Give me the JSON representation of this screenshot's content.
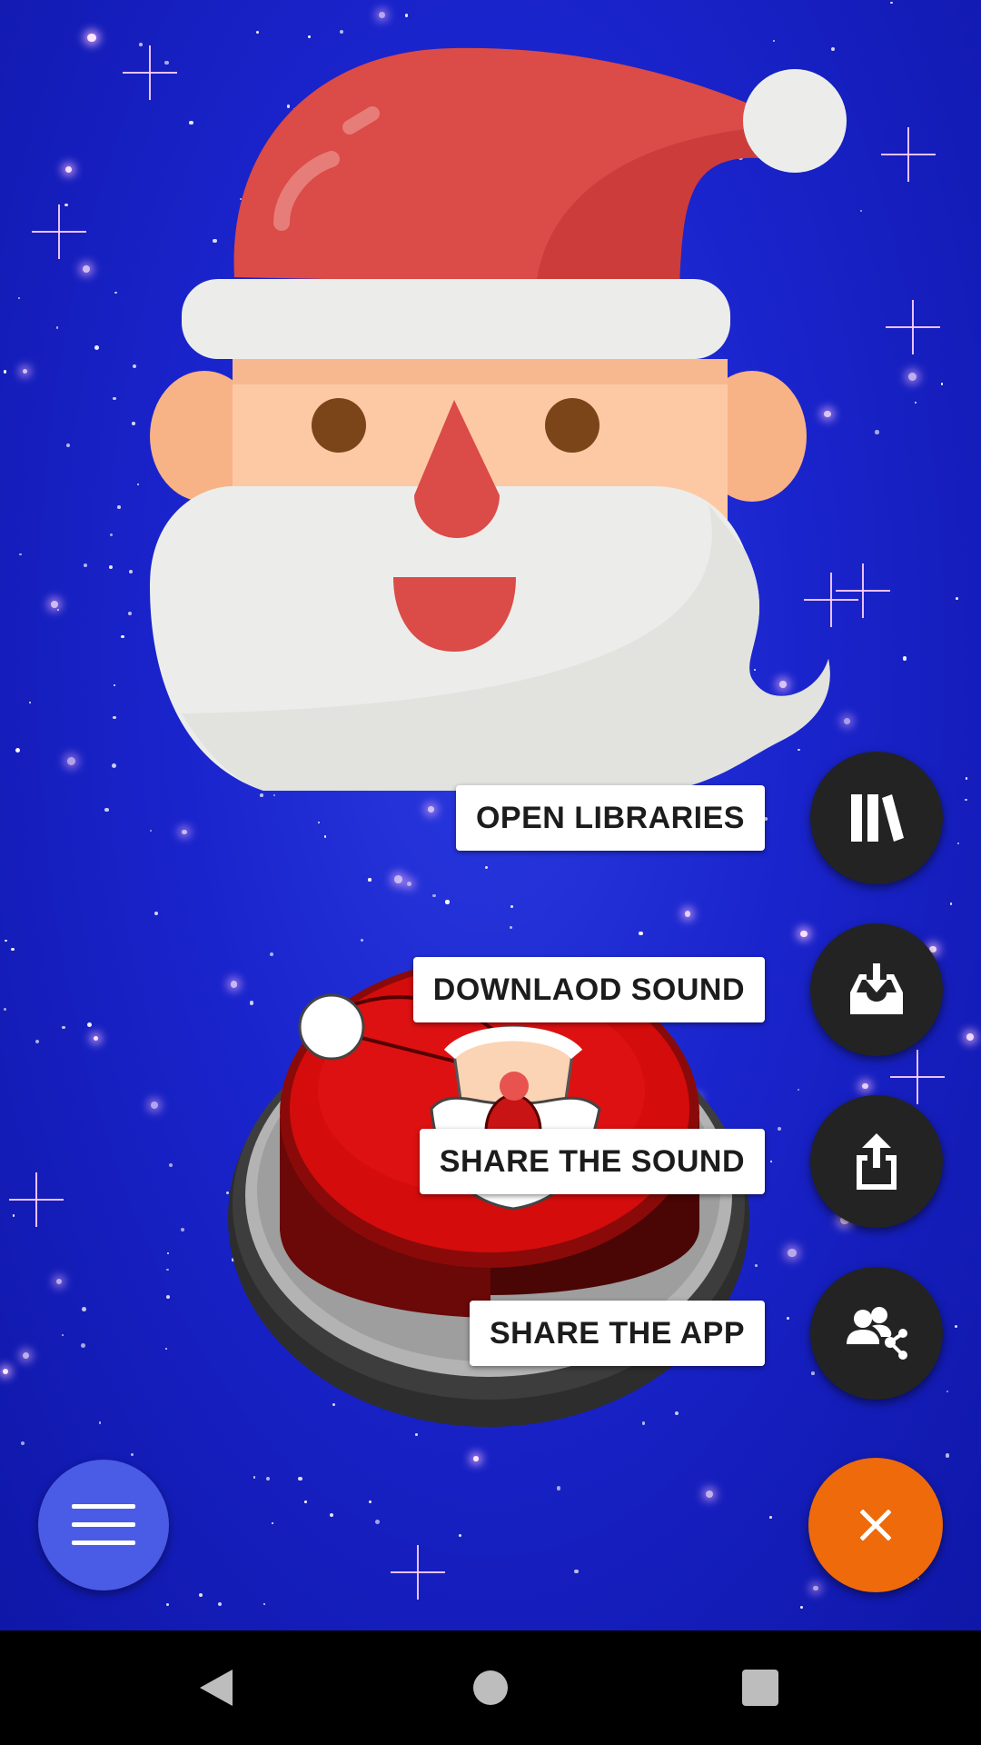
{
  "fab_menu": {
    "items": [
      {
        "label": "OPEN LIBRARIES",
        "icon": "library-icon"
      },
      {
        "label": "DOWNLAOD SOUND",
        "icon": "download-icon"
      },
      {
        "label": "SHARE THE SOUND",
        "icon": "share-icon"
      },
      {
        "label": "SHARE THE APP",
        "icon": "share-users-icon"
      }
    ],
    "close_icon": "close-icon",
    "close_color": "#EE6A0B",
    "mini_fab_color": "#232323"
  },
  "menu_button": {
    "icon": "hamburger-menu-icon",
    "color": "#4A5BE6"
  },
  "background": {
    "color": "#1A24CC",
    "theme": "starry-sky"
  },
  "navigation": {
    "back_icon": "back-icon",
    "home_icon": "home-icon",
    "recents_icon": "recents-icon"
  }
}
